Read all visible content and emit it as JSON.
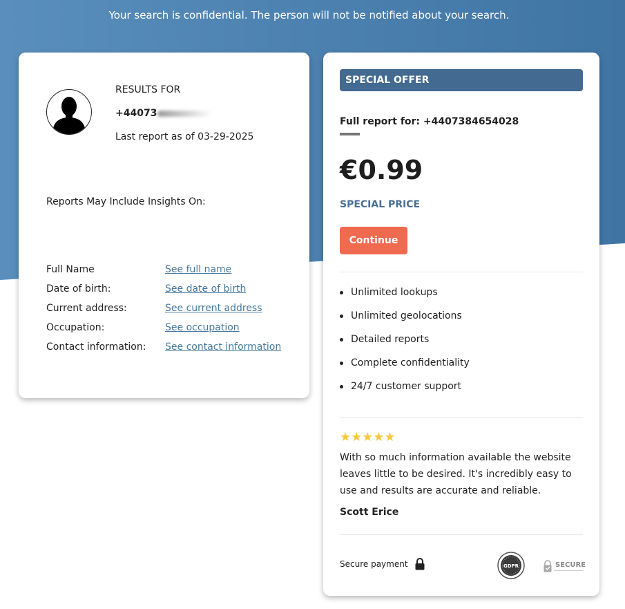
{
  "notice": "Your search is confidential. The person will not be notified about your search.",
  "left_card": {
    "results_label": "RESULTS FOR",
    "phone_partial": "+44073",
    "last_report": "Last report as of 03-29-2025",
    "insights_title": "Reports May Include Insights On:",
    "insights": [
      {
        "label": "Full Name",
        "link": "See full name"
      },
      {
        "label": "Date of birth:",
        "link": "See date of birth"
      },
      {
        "label": "Current address:",
        "link": "See current address"
      },
      {
        "label": "Occupation:",
        "link": "See occupation"
      },
      {
        "label": "Contact information:",
        "link": "See contact information"
      }
    ]
  },
  "right_card": {
    "banner": "SPECIAL OFFER",
    "full_report": "Full report for: +4407384654028",
    "price": "€0.99",
    "special_price": "SPECIAL PRICE",
    "continue_label": "Continue",
    "features": [
      "Unlimited lookups",
      "Unlimited geolocations",
      "Detailed reports",
      "Complete confidentiality",
      "24/7 customer support"
    ],
    "rating": "★★★★★",
    "testimonial": "With so much information available the website leaves little to be desired. It's incredibly easy to use and results are accurate and reliable.",
    "author": "Scott Erice",
    "secure_payment": "Secure payment",
    "gdpr_badge_text": "GDPR",
    "secure_badge_text": "SECURE"
  },
  "colors": {
    "header_blue": "#4a7fae",
    "banner_blue": "#436a90",
    "cta_orange": "#ef6a4f",
    "link_blue": "#45799f",
    "star_yellow": "#f6c93c"
  }
}
